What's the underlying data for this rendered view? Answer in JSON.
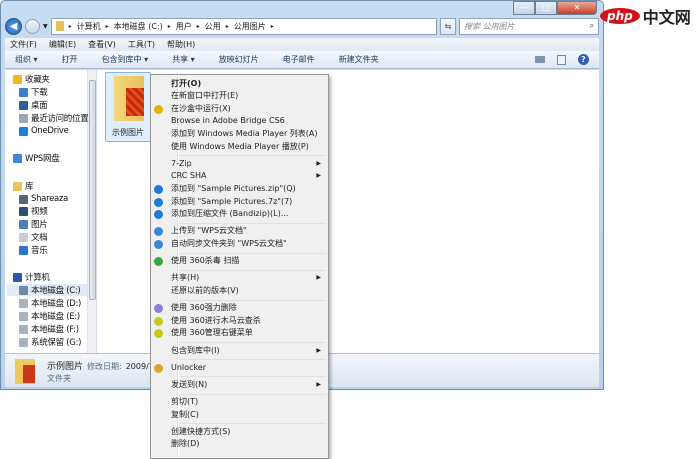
{
  "window": {
    "min": "—",
    "max": "□",
    "close": "✕"
  },
  "address": {
    "crumbs": [
      "计算机",
      "本地磁盘 (C:)",
      "用户",
      "公用",
      "公用图片"
    ],
    "search_placeholder": "搜索 公用图片"
  },
  "menubar": [
    "文件(F)",
    "编辑(E)",
    "查看(V)",
    "工具(T)",
    "帮助(H)"
  ],
  "toolbar": [
    "组织 ▾",
    "打开",
    "包含到库中 ▾",
    "共享 ▾",
    "放映幻灯片",
    "电子邮件",
    "新建文件夹"
  ],
  "nav": [
    {
      "label": "收藏夹",
      "icon": "star-icon",
      "color": "#f2b61d",
      "indent": 0
    },
    {
      "label": "下载",
      "icon": "download-folder-icon",
      "color": "#3c7fc9",
      "indent": 1
    },
    {
      "label": "桌面",
      "icon": "desktop-icon",
      "color": "#2d5d9b",
      "indent": 1
    },
    {
      "label": "最近访问的位置",
      "icon": "recent-places-icon",
      "color": "#9aa6b3",
      "indent": 1
    },
    {
      "label": "OneDrive",
      "icon": "cloud-icon",
      "color": "#1b7fd6",
      "indent": 1
    },
    {
      "label": "WPS网盘",
      "icon": "wps-cloud-icon",
      "color": "#3a8ad9",
      "indent": 0
    },
    {
      "label": "库",
      "icon": "library-icon",
      "color": "#e9c35c",
      "indent": 0
    },
    {
      "label": "Shareaza",
      "icon": "shareaza-icon",
      "color": "#556677",
      "indent": 1
    },
    {
      "label": "视频",
      "icon": "video-icon",
      "color": "#2f4d75",
      "indent": 1
    },
    {
      "label": "图片",
      "icon": "pictures-icon",
      "color": "#4c7fb5",
      "indent": 1
    },
    {
      "label": "文档",
      "icon": "documents-icon",
      "color": "#c9ced6",
      "indent": 1
    },
    {
      "label": "音乐",
      "icon": "music-icon",
      "color": "#2a77c9",
      "indent": 1
    },
    {
      "label": "计算机",
      "icon": "computer-icon",
      "color": "#2d56a3",
      "indent": 0
    },
    {
      "label": "本地磁盘 (C:)",
      "icon": "drive-icon",
      "color": "#6e8aa8",
      "indent": 1
    },
    {
      "label": "本地磁盘 (D:)",
      "icon": "drive-icon",
      "color": "#aab3bd",
      "indent": 1
    },
    {
      "label": "本地磁盘 (E:)",
      "icon": "drive-icon",
      "color": "#aab3bd",
      "indent": 1
    },
    {
      "label": "本地磁盘 (F:)",
      "icon": "drive-icon",
      "color": "#aab3bd",
      "indent": 1
    },
    {
      "label": "系统保留 (G:)",
      "icon": "drive-icon",
      "color": "#aab3bd",
      "indent": 1
    }
  ],
  "folder": {
    "name": "示例图片"
  },
  "status": {
    "name": "示例图片",
    "modified_label": "修改日期:",
    "modified": "2009/7/14",
    "type": "文件夹"
  },
  "context_menu": [
    {
      "label": "打开(O)",
      "bold": true
    },
    {
      "label": "在新窗口中打开(E)"
    },
    {
      "label": "在沙盒中运行(X)",
      "icon": "sandbox-icon",
      "color": "#e2b400"
    },
    {
      "label": "Browse in Adobe Bridge CS6"
    },
    {
      "label": "添加到 Windows Media Player 列表(A)"
    },
    {
      "label": "使用 Windows Media Player 播放(P)"
    },
    {
      "sep": true
    },
    {
      "label": "7-Zip",
      "sub": true
    },
    {
      "label": "CRC SHA",
      "sub": true
    },
    {
      "label": "添加到 \"Sample Pictures.zip\"(Q)",
      "icon": "bandizip-icon",
      "color": "#1e7ad6"
    },
    {
      "label": "添加到 \"Sample Pictures.7z\"(7)",
      "icon": "bandizip-icon",
      "color": "#1e7ad6"
    },
    {
      "label": "添加到压缩文件 (Bandizip)(L)...",
      "icon": "bandizip-icon",
      "color": "#1e7ad6"
    },
    {
      "sep": true
    },
    {
      "label": "上传到 \"WPS云文档\"",
      "icon": "upload-cloud-icon",
      "color": "#3a86d8"
    },
    {
      "label": "自动同步文件夹到 \"WPS云文档\"",
      "icon": "sync-folder-icon",
      "color": "#3a86d8"
    },
    {
      "sep": true
    },
    {
      "label": "使用 360杀毒 扫描",
      "icon": "shield-icon",
      "color": "#3fa63a"
    },
    {
      "sep": true
    },
    {
      "label": "共享(H)",
      "sub": true
    },
    {
      "label": "还原以前的版本(V)"
    },
    {
      "sep": true
    },
    {
      "label": "使用 360强力删除",
      "icon": "trash-icon",
      "color": "#8a7fd8"
    },
    {
      "label": "使用 360进行木马云查杀",
      "icon": "360-icon",
      "color": "#c9c81a"
    },
    {
      "label": "使用 360管理右键菜单",
      "icon": "360-icon",
      "color": "#c9c81a"
    },
    {
      "sep": true
    },
    {
      "label": "包含到库中(I)",
      "sub": true
    },
    {
      "sep": true
    },
    {
      "label": "Unlocker",
      "icon": "unlocker-wand-icon",
      "color": "#d9a52a"
    },
    {
      "sep": true
    },
    {
      "label": "发送到(N)",
      "sub": true
    },
    {
      "sep": true
    },
    {
      "label": "剪切(T)"
    },
    {
      "label": "复制(C)"
    },
    {
      "sep": true
    },
    {
      "label": "创建快捷方式(S)"
    },
    {
      "label": "删除(D)"
    }
  ],
  "watermark": {
    "brand": "php",
    "text": "中文网"
  }
}
